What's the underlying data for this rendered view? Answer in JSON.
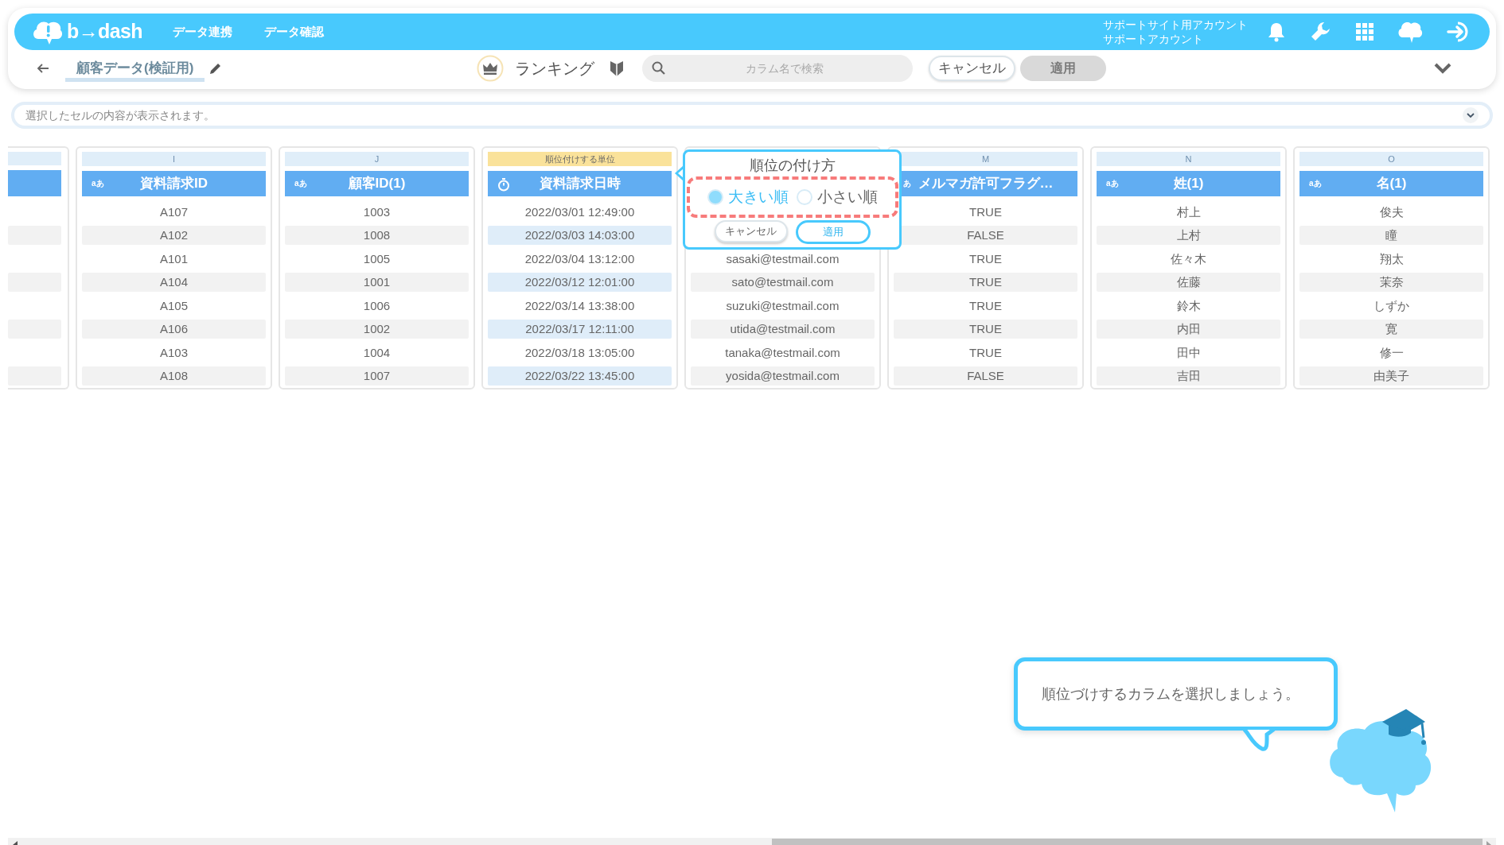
{
  "header": {
    "logo": "b→dash",
    "nav": [
      {
        "label": "データ連携"
      },
      {
        "label": "データ確認"
      }
    ],
    "account": [
      "サポートサイト用アカウント",
      "サポートアカウント"
    ]
  },
  "toolbar": {
    "title": "顧客データ(検証用)",
    "mode": "ランキング",
    "search": {
      "placeholder": "カラム名で検索"
    },
    "cancel": "キャンセル",
    "apply": {
      "label": "適用",
      "disabled": true
    }
  },
  "cell_viewer": {
    "placeholder": "選択したセルの内容が表示されます。"
  },
  "columns": [
    {
      "kind": "partial"
    },
    {
      "kind": "text",
      "letter": "I",
      "type_label": "aあ",
      "title": "資料請求ID",
      "highlighted": false,
      "cells": [
        "A107",
        "A102",
        "A101",
        "A104",
        "A105",
        "A106",
        "A103",
        "A108"
      ]
    },
    {
      "kind": "text",
      "letter": "J",
      "type_label": "aあ",
      "title": "顧客ID(1)",
      "highlighted": false,
      "cells": [
        "1003",
        "1008",
        "1005",
        "1001",
        "1006",
        "1002",
        "1004",
        "1007"
      ]
    },
    {
      "kind": "date",
      "unit_label": "順位付けする単位",
      "title": "資料請求日時",
      "highlighted": true,
      "cells": [
        "2022/03/01 12:49:00",
        "2022/03/03 14:03:00",
        "2022/03/04 13:12:00",
        "2022/03/12 12:01:00",
        "2022/03/14 13:38:00",
        "2022/03/17 12:11:00",
        "2022/03/18 13:05:00",
        "2022/03/22 13:45:00"
      ]
    },
    {
      "kind": "covered",
      "highlighted": false,
      "cells": [
        "sasaki@testmail.com",
        "sato@testmail.com",
        "suzuki@testmail.com",
        "utida@testmail.com",
        "tanaka@testmail.com",
        "yosida@testmail.com"
      ]
    },
    {
      "kind": "text",
      "letter": "M",
      "type_label": "あ",
      "title": "メルマガ許可フラグ…",
      "highlighted": false,
      "cells": [
        "TRUE",
        "FALSE",
        "TRUE",
        "TRUE",
        "TRUE",
        "TRUE",
        "TRUE",
        "FALSE"
      ]
    },
    {
      "kind": "text",
      "letter": "N",
      "type_label": "aあ",
      "title": "姓(1)",
      "highlighted": false,
      "cells": [
        "村上",
        "上村",
        "佐々木",
        "佐藤",
        "鈴木",
        "内田",
        "田中",
        "吉田"
      ]
    },
    {
      "kind": "text",
      "letter": "O",
      "type_label": "aあ",
      "title": "名(1)",
      "highlighted": false,
      "cells": [
        "俊夫",
        "瞳",
        "翔太",
        "茉奈",
        "しずか",
        "寛",
        "修一",
        "由美子"
      ]
    }
  ],
  "ranking_popup": {
    "title": "順位の付け方",
    "options": [
      {
        "label": "大きい順",
        "selected": true
      },
      {
        "label": "小さい順",
        "selected": false
      }
    ],
    "cancel": "キャンセル",
    "apply": "適用"
  },
  "guide": {
    "message": "順位づけするカラムを選択しましょう。"
  }
}
